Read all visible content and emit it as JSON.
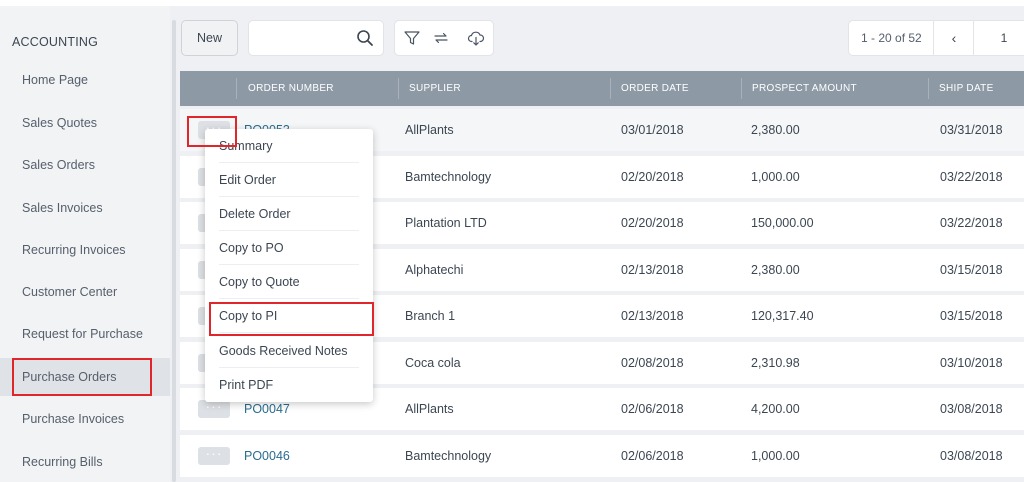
{
  "sidebar": {
    "section_title": "ACCOUNTING",
    "items": [
      {
        "label": "Home Page"
      },
      {
        "label": "Sales Quotes"
      },
      {
        "label": "Sales Orders"
      },
      {
        "label": "Sales Invoices"
      },
      {
        "label": "Recurring Invoices"
      },
      {
        "label": "Customer Center"
      },
      {
        "label": "Request for Purchase"
      },
      {
        "label": "Purchase Orders"
      },
      {
        "label": "Purchase Invoices"
      },
      {
        "label": "Recurring Bills"
      }
    ],
    "active_item": "Purchase Orders"
  },
  "toolbar": {
    "new_label": "New",
    "search_value": "",
    "icons": [
      "search-icon",
      "filter-icon",
      "repeat-icon",
      "cloud-download-icon"
    ],
    "pagination": {
      "range": "1 - 20 of 52",
      "prev": "‹",
      "page": "1"
    }
  },
  "table": {
    "columns": [
      "ORDER NUMBER",
      "SUPPLIER",
      "ORDER DATE",
      "PROSPECT AMOUNT",
      "SHIP DATE"
    ],
    "rows": [
      {
        "order": "PO0053",
        "supplier": "AllPlants",
        "order_date": "03/01/2018",
        "amount": "2,380.00",
        "ship_date": "03/31/2018"
      },
      {
        "order": "",
        "supplier": "Bamtechnology",
        "order_date": "02/20/2018",
        "amount": "1,000.00",
        "ship_date": "03/22/2018"
      },
      {
        "order": "",
        "supplier": "Plantation LTD",
        "order_date": "02/20/2018",
        "amount": "150,000.00",
        "ship_date": "03/22/2018"
      },
      {
        "order": "",
        "supplier": "Alphatechi",
        "order_date": "02/13/2018",
        "amount": "2,380.00",
        "ship_date": "03/15/2018"
      },
      {
        "order": "",
        "supplier": "Branch 1",
        "order_date": "02/13/2018",
        "amount": "120,317.40",
        "ship_date": "03/15/2018"
      },
      {
        "order": "",
        "supplier": "Coca cola",
        "order_date": "02/08/2018",
        "amount": "2,310.98",
        "ship_date": "03/10/2018"
      },
      {
        "order": "PO0047",
        "supplier": "AllPlants",
        "order_date": "02/06/2018",
        "amount": "4,200.00",
        "ship_date": "03/08/2018"
      },
      {
        "order": "PO0046",
        "supplier": "Bamtechnology",
        "order_date": "02/06/2018",
        "amount": "1,000.00",
        "ship_date": "03/08/2018"
      }
    ],
    "row_action_glyph": "···"
  },
  "context_menu": {
    "items": [
      {
        "label": "Summary"
      },
      {
        "label": "Edit Order"
      },
      {
        "label": "Delete Order"
      },
      {
        "label": "Copy to PO"
      },
      {
        "label": "Copy to Quote"
      },
      {
        "label": "Copy to PI"
      },
      {
        "label": "Goods Received Notes"
      },
      {
        "label": "Print PDF"
      }
    ]
  },
  "colors": {
    "table_header": "#8d9aa6",
    "highlight": "#e0252b",
    "link": "#2a6d8f",
    "active_sidebar": "#dfe2e6"
  }
}
